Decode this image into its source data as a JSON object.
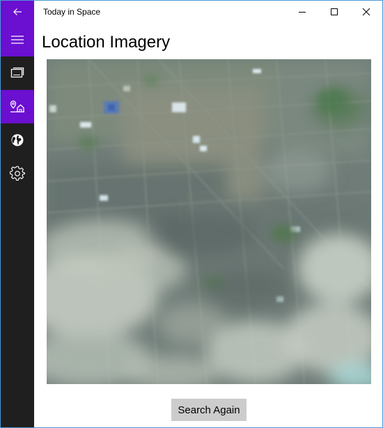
{
  "window": {
    "title": "Today in Space"
  },
  "titlebar": {
    "back_icon": "arrow-left-icon",
    "minimize_icon": "minimize-icon",
    "maximize_icon": "maximize-icon",
    "close_icon": "close-icon"
  },
  "nav": {
    "accent_color": "#6b0fd0",
    "rail_color": "#1f1f1f",
    "items": [
      {
        "icon": "hamburger-icon"
      },
      {
        "icon": "slides-icon"
      },
      {
        "icon": "location-home-icon",
        "selected": true
      },
      {
        "icon": "globe-icon"
      },
      {
        "icon": "gear-icon"
      }
    ]
  },
  "page": {
    "title": "Location Imagery"
  },
  "actions": {
    "search_again": "Search Again"
  }
}
